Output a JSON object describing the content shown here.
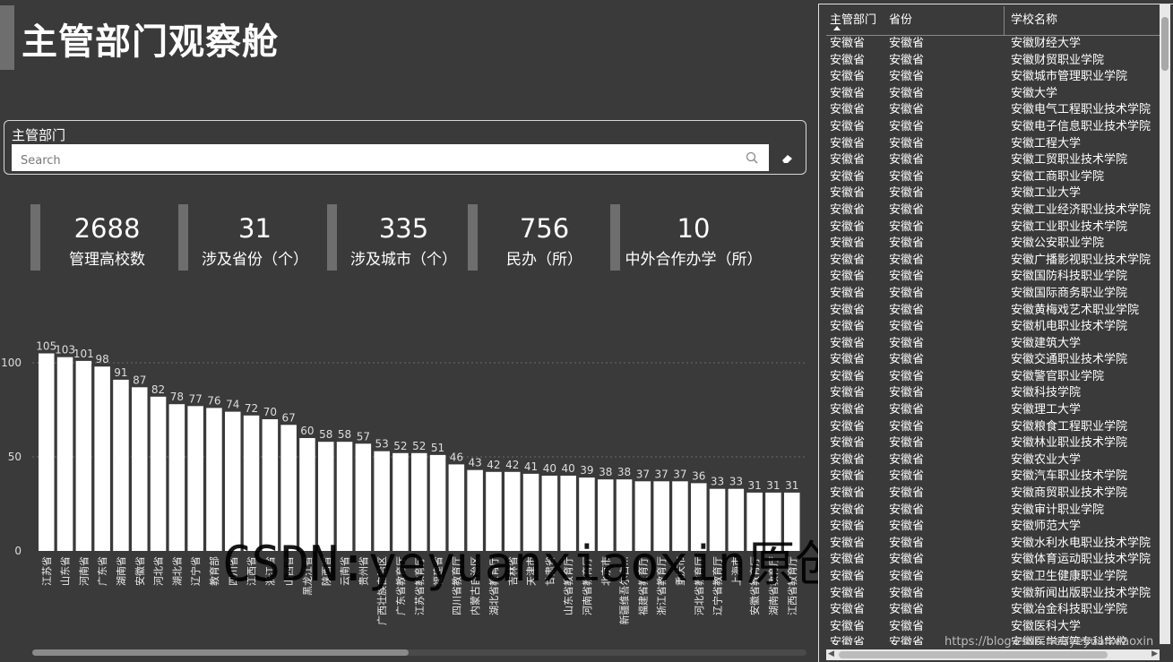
{
  "page": {
    "title": "主管部门观察舱"
  },
  "slicer": {
    "label": "主管部门",
    "placeholder": "Search"
  },
  "cards": [
    {
      "value": "2688",
      "label": "管理高校数"
    },
    {
      "value": "31",
      "label": "涉及省份（个）"
    },
    {
      "value": "335",
      "label": "涉及城市（个）"
    },
    {
      "value": "756",
      "label": "民办（所）"
    },
    {
      "value": "10",
      "label": "中外合作办学（所）"
    }
  ],
  "chart_data": {
    "type": "bar",
    "categories": [
      "江苏省",
      "山东省",
      "河南省",
      "广东省",
      "湖南省",
      "安徽省",
      "河北省",
      "湖北省",
      "辽宁省",
      "教育部",
      "四川省",
      "江西省",
      "浙江省",
      "山西省",
      "黑龙江省",
      "陕西省",
      "云南省",
      "贵州省",
      "广西壮族自治区",
      "广东省教育厅",
      "江苏省教育厅",
      "福建省",
      "四川省教育厅",
      "内蒙古自治区",
      "湖北省教育厅",
      "吉林省",
      "天津市",
      "甘肃省",
      "山东省教育厅",
      "河南省教育厅",
      "北京市",
      "新疆维吾尔自...",
      "福建省教育厅",
      "浙江省教育厅",
      "重庆市",
      "河北省教育厅",
      "辽宁省教育厅",
      "上海市",
      "安徽省教育厅",
      "湖南省教育厅",
      "江西省教育厅"
    ],
    "values": [
      105,
      103,
      101,
      98,
      91,
      87,
      82,
      78,
      77,
      76,
      74,
      72,
      70,
      67,
      60,
      58,
      58,
      57,
      53,
      52,
      52,
      51,
      46,
      43,
      42,
      42,
      41,
      40,
      40,
      39,
      38,
      38,
      37,
      37,
      37,
      36,
      33,
      33,
      31,
      31,
      31
    ],
    "yticks": [
      0,
      50,
      100
    ],
    "ylim": [
      0,
      110
    ],
    "grid": true
  },
  "watermark": {
    "text": "CSDN:yeyuanxiaoxin原创",
    "url": "https://blog.csdn.net/yeyuanxiaoxin"
  },
  "table": {
    "headers": [
      "主管部门",
      "省份",
      "学校名称"
    ],
    "rows": [
      [
        "安徽省",
        "安徽省",
        "安徽财经大学"
      ],
      [
        "安徽省",
        "安徽省",
        "安徽财贸职业学院"
      ],
      [
        "安徽省",
        "安徽省",
        "安徽城市管理职业学院"
      ],
      [
        "安徽省",
        "安徽省",
        "安徽大学"
      ],
      [
        "安徽省",
        "安徽省",
        "安徽电气工程职业技术学院"
      ],
      [
        "安徽省",
        "安徽省",
        "安徽电子信息职业技术学院"
      ],
      [
        "安徽省",
        "安徽省",
        "安徽工程大学"
      ],
      [
        "安徽省",
        "安徽省",
        "安徽工贸职业技术学院"
      ],
      [
        "安徽省",
        "安徽省",
        "安徽工商职业学院"
      ],
      [
        "安徽省",
        "安徽省",
        "安徽工业大学"
      ],
      [
        "安徽省",
        "安徽省",
        "安徽工业经济职业技术学院"
      ],
      [
        "安徽省",
        "安徽省",
        "安徽工业职业技术学院"
      ],
      [
        "安徽省",
        "安徽省",
        "安徽公安职业学院"
      ],
      [
        "安徽省",
        "安徽省",
        "安徽广播影视职业技术学院"
      ],
      [
        "安徽省",
        "安徽省",
        "安徽国防科技职业学院"
      ],
      [
        "安徽省",
        "安徽省",
        "安徽国际商务职业学院"
      ],
      [
        "安徽省",
        "安徽省",
        "安徽黄梅戏艺术职业学院"
      ],
      [
        "安徽省",
        "安徽省",
        "安徽机电职业技术学院"
      ],
      [
        "安徽省",
        "安徽省",
        "安徽建筑大学"
      ],
      [
        "安徽省",
        "安徽省",
        "安徽交通职业技术学院"
      ],
      [
        "安徽省",
        "安徽省",
        "安徽警官职业学院"
      ],
      [
        "安徽省",
        "安徽省",
        "安徽科技学院"
      ],
      [
        "安徽省",
        "安徽省",
        "安徽理工大学"
      ],
      [
        "安徽省",
        "安徽省",
        "安徽粮食工程职业学院"
      ],
      [
        "安徽省",
        "安徽省",
        "安徽林业职业技术学院"
      ],
      [
        "安徽省",
        "安徽省",
        "安徽农业大学"
      ],
      [
        "安徽省",
        "安徽省",
        "安徽汽车职业技术学院"
      ],
      [
        "安徽省",
        "安徽省",
        "安徽商贸职业技术学院"
      ],
      [
        "安徽省",
        "安徽省",
        "安徽审计职业学院"
      ],
      [
        "安徽省",
        "安徽省",
        "安徽师范大学"
      ],
      [
        "安徽省",
        "安徽省",
        "安徽水利水电职业技术学院"
      ],
      [
        "安徽省",
        "安徽省",
        "安徽体育运动职业技术学院"
      ],
      [
        "安徽省",
        "安徽省",
        "安徽卫生健康职业学院"
      ],
      [
        "安徽省",
        "安徽省",
        "安徽新闻出版职业技术学院"
      ],
      [
        "安徽省",
        "安徽省",
        "安徽冶金科技职业学院"
      ],
      [
        "安徽省",
        "安徽省",
        "安徽医科大学"
      ],
      [
        "安徽省",
        "安徽省",
        "安徽医学高等专科学校"
      ]
    ]
  }
}
